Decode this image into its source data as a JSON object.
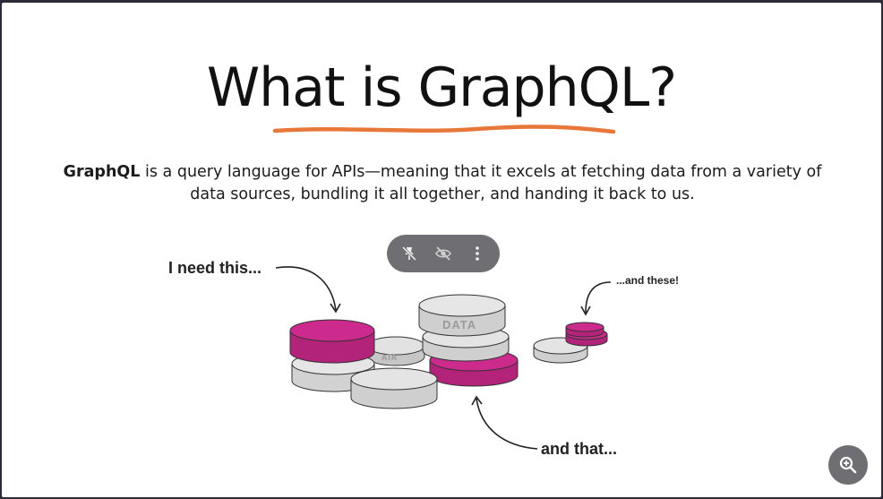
{
  "slide": {
    "title": "What is GraphQL?",
    "desc_bold": "GraphQL",
    "desc_line1": " is a query language for APIs—meaning that it excels at fetching data from a variety of",
    "desc_line2": "data sources, bundling it all together, and handing it back to us.",
    "accent_color": "#e8773a",
    "magenta": "#cc2a8c"
  },
  "illustration": {
    "caption_need": "I need this...",
    "caption_these": "...and these!",
    "caption_that": "and that...",
    "disk_label": "DATA",
    "disk_label_partial": "ATA"
  },
  "toolbar": {
    "items": [
      {
        "icon": "pin-off-icon"
      },
      {
        "icon": "eye-off-icon"
      },
      {
        "icon": "more-vert-icon"
      }
    ]
  },
  "zoom_button": {
    "icon": "zoom-in-icon"
  }
}
